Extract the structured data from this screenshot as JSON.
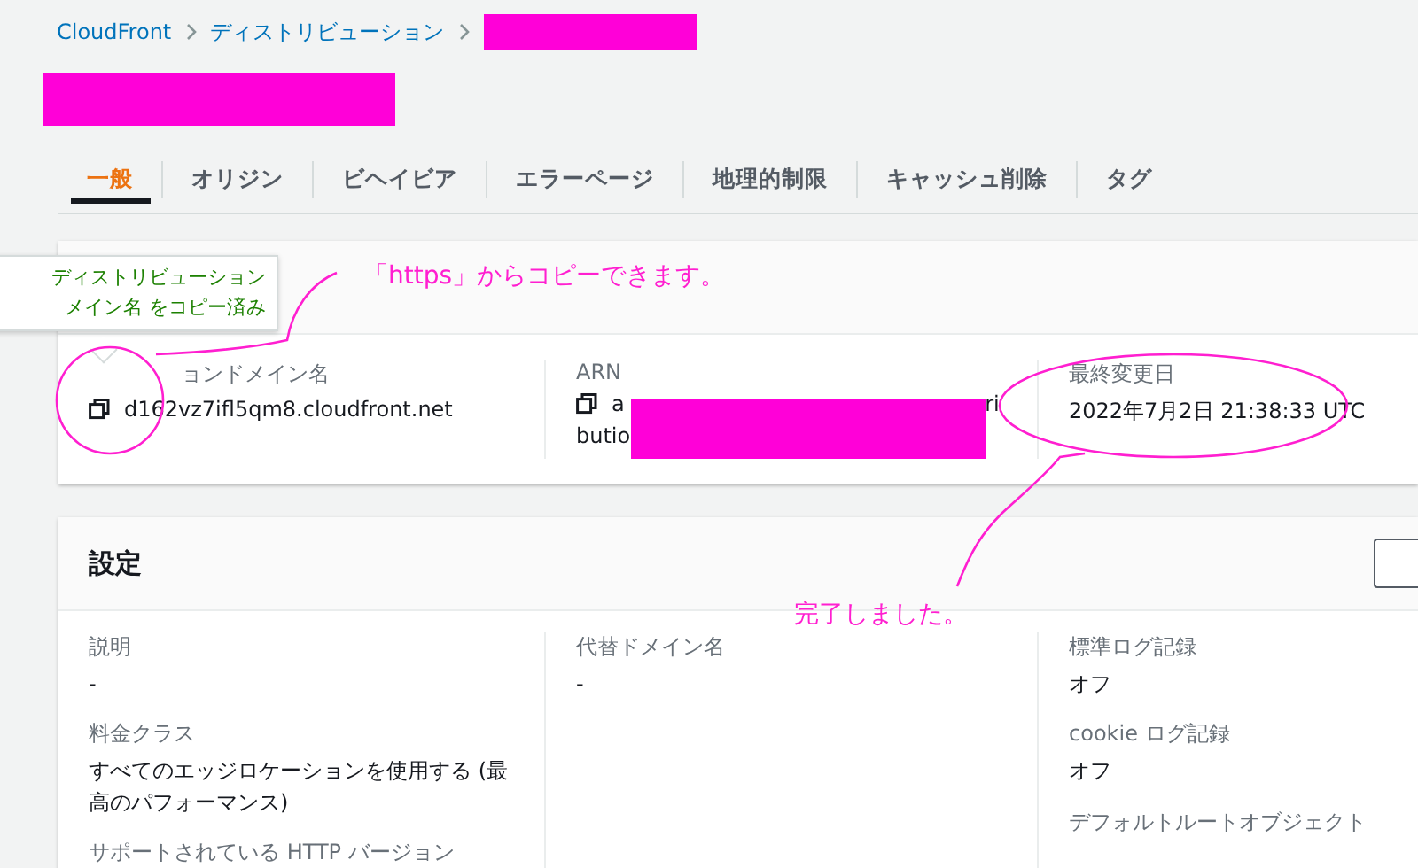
{
  "breadcrumb": [
    {
      "label": "CloudFront",
      "kind": "link"
    },
    {
      "label": "ディストリビューション",
      "kind": "link"
    },
    {
      "kind": "redacted"
    }
  ],
  "page_title": {
    "kind": "redacted"
  },
  "tabs": [
    {
      "label": "一般",
      "selected": true
    },
    {
      "label": "オリジン",
      "selected": false
    },
    {
      "label": "ビヘイビア",
      "selected": false
    },
    {
      "label": "エラーページ",
      "selected": false
    },
    {
      "label": "地理的制限",
      "selected": false
    },
    {
      "label": "キャッシュ削除",
      "selected": false
    },
    {
      "label": "タグ",
      "selected": false
    }
  ],
  "details": {
    "tooltip": [
      "ディストリビューション",
      "メイン名 をコピー済み"
    ],
    "fields": [
      {
        "kind": "copy",
        "label": "ョンドメイン名",
        "value": "d162vz7ifl5qm8.cloudfront.net"
      },
      {
        "kind": "redacted",
        "label": "ARN",
        "value_start": "a",
        "value_end": "ri",
        "value_line2": "butio"
      },
      {
        "kind": "text",
        "label": "最終変更日",
        "value": "2022年7月2日 21:38:33 UTC"
      }
    ]
  },
  "settings": {
    "title": "設定",
    "columns": [
      [
        {
          "label": "説明",
          "value": "-"
        },
        {
          "label": "料金クラス",
          "value": "すべてのエッジロケーションを使用する (最高のパフォーマンス)"
        },
        {
          "label": "サポートされている HTTP バージョン"
        }
      ],
      [
        {
          "label": "代替ドメイン名",
          "value": "-"
        }
      ],
      [
        {
          "label": "標準ログ記録",
          "value": "オフ"
        },
        {
          "label": "cookie ログ記録",
          "value": "オフ"
        },
        {
          "label": "デフォルトルートオブジェクト"
        }
      ]
    ]
  },
  "annotations": [
    {
      "text": "「https」からコピーできます。"
    },
    {
      "text": "完了しました。"
    }
  ]
}
